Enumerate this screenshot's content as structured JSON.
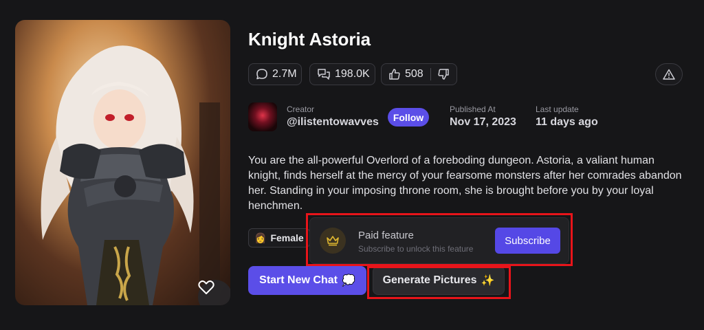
{
  "character": {
    "name": "Knight Astoria",
    "description": "You are the all-powerful Overlord of a foreboding dungeon. Astoria, a valiant human knight, finds herself at the mercy of your fearsome monsters after her comrades abandon her. Standing in your imposing throne room, she is brought before you by your loyal henchmen."
  },
  "stats": {
    "chats": "2.7M",
    "messages": "198.0K",
    "likes": "508"
  },
  "creator": {
    "label": "Creator",
    "handle": "@ilistentowavves",
    "follow_label": "Follow"
  },
  "published": {
    "label": "Published At",
    "value": "Nov 17, 2023"
  },
  "updated": {
    "label": "Last update",
    "value": "11 days ago"
  },
  "tag": {
    "emoji": "👩",
    "label": "Female"
  },
  "paid": {
    "title": "Paid feature",
    "subtitle": "Subscribe to unlock this feature",
    "subscribe_label": "Subscribe"
  },
  "actions": {
    "start_chat": "Start New Chat",
    "start_emoji": "💭",
    "generate": "Generate Pictures",
    "generate_emoji": "✨"
  },
  "colors": {
    "accent": "#5b4ee8",
    "highlight": "#e8141a",
    "background": "#161618"
  }
}
